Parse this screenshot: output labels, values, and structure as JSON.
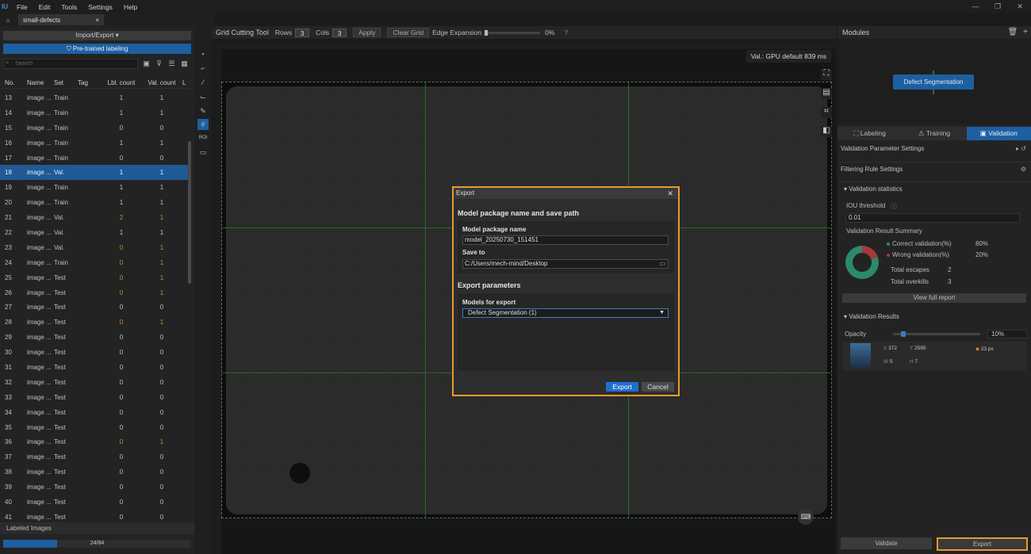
{
  "app": {
    "logo": "IU",
    "menus": [
      "File",
      "Edit",
      "Tools",
      "Settings",
      "Help"
    ],
    "window_controls": [
      "—",
      "❐",
      "✕"
    ]
  },
  "tabs": {
    "home_icon": "home-icon",
    "project": "small-defects",
    "close": "×"
  },
  "left": {
    "import_export": "Import/Export ▾",
    "pretrained": "Pre-trained labeling",
    "search_placeholder": "Search",
    "columns": [
      "No.",
      "Name",
      "Set",
      "Tag",
      "Lbl. count",
      "Val. count",
      "L"
    ],
    "rows": [
      {
        "no": "13",
        "name": "image ...",
        "set": "Train",
        "lbl": "1",
        "val": "1",
        "lblc": "",
        "valc": ""
      },
      {
        "no": "14",
        "name": "image ...",
        "set": "Train",
        "lbl": "1",
        "val": "1",
        "lblc": "",
        "valc": ""
      },
      {
        "no": "15",
        "name": "image ...",
        "set": "Train",
        "lbl": "0",
        "val": "0",
        "lblc": "",
        "valc": ""
      },
      {
        "no": "16",
        "name": "image ...",
        "set": "Train",
        "lbl": "1",
        "val": "1",
        "lblc": "",
        "valc": ""
      },
      {
        "no": "17",
        "name": "image ...",
        "set": "Train",
        "lbl": "0",
        "val": "0",
        "lblc": "",
        "valc": ""
      },
      {
        "no": "18",
        "name": "image ...",
        "set": "Val.",
        "lbl": "1",
        "val": "1",
        "lblc": "",
        "valc": "",
        "selected": true
      },
      {
        "no": "19",
        "name": "image ...",
        "set": "Train",
        "lbl": "1",
        "val": "1",
        "lblc": "",
        "valc": ""
      },
      {
        "no": "20",
        "name": "image ...",
        "set": "Train",
        "lbl": "1",
        "val": "1",
        "lblc": "",
        "valc": ""
      },
      {
        "no": "21",
        "name": "image ...",
        "set": "Val.",
        "lbl": "2",
        "val": "1",
        "lblc": "orange",
        "valc": "green"
      },
      {
        "no": "22",
        "name": "image ...",
        "set": "Val.",
        "lbl": "1",
        "val": "1",
        "lblc": "",
        "valc": ""
      },
      {
        "no": "23",
        "name": "image ...",
        "set": "Val.",
        "lbl": "0",
        "val": "1",
        "lblc": "orange",
        "valc": "green"
      },
      {
        "no": "24",
        "name": "image ...",
        "set": "Train",
        "lbl": "0",
        "val": "1",
        "lblc": "orange",
        "valc": "green"
      },
      {
        "no": "25",
        "name": "image ...",
        "set": "Test",
        "lbl": "0",
        "val": "1",
        "lblc": "orange",
        "valc": "green"
      },
      {
        "no": "26",
        "name": "image ...",
        "set": "Test",
        "lbl": "0",
        "val": "1",
        "lblc": "orange",
        "valc": "green"
      },
      {
        "no": "27",
        "name": "image ...",
        "set": "Test",
        "lbl": "0",
        "val": "0",
        "lblc": "",
        "valc": ""
      },
      {
        "no": "28",
        "name": "image ...",
        "set": "Test",
        "lbl": "0",
        "val": "1",
        "lblc": "orange",
        "valc": "green"
      },
      {
        "no": "29",
        "name": "image ...",
        "set": "Test",
        "lbl": "0",
        "val": "0",
        "lblc": "",
        "valc": ""
      },
      {
        "no": "30",
        "name": "image ...",
        "set": "Test",
        "lbl": "0",
        "val": "0",
        "lblc": "",
        "valc": ""
      },
      {
        "no": "31",
        "name": "image ...",
        "set": "Test",
        "lbl": "0",
        "val": "0",
        "lblc": "",
        "valc": ""
      },
      {
        "no": "32",
        "name": "image ...",
        "set": "Test",
        "lbl": "0",
        "val": "0",
        "lblc": "",
        "valc": ""
      },
      {
        "no": "33",
        "name": "image ...",
        "set": "Test",
        "lbl": "0",
        "val": "0",
        "lblc": "",
        "valc": ""
      },
      {
        "no": "34",
        "name": "image ...",
        "set": "Test",
        "lbl": "0",
        "val": "0",
        "lblc": "",
        "valc": ""
      },
      {
        "no": "35",
        "name": "image ...",
        "set": "Test",
        "lbl": "0",
        "val": "0",
        "lblc": "",
        "valc": ""
      },
      {
        "no": "36",
        "name": "image ...",
        "set": "Test",
        "lbl": "0",
        "val": "1",
        "lblc": "orange",
        "valc": "green"
      },
      {
        "no": "37",
        "name": "image ...",
        "set": "Test",
        "lbl": "0",
        "val": "0",
        "lblc": "",
        "valc": ""
      },
      {
        "no": "38",
        "name": "image ...",
        "set": "Test",
        "lbl": "0",
        "val": "0",
        "lblc": "",
        "valc": ""
      },
      {
        "no": "39",
        "name": "image ...",
        "set": "Test",
        "lbl": "0",
        "val": "0",
        "lblc": "",
        "valc": ""
      },
      {
        "no": "40",
        "name": "image ...",
        "set": "Test",
        "lbl": "0",
        "val": "0",
        "lblc": "",
        "valc": ""
      },
      {
        "no": "41",
        "name": "image ...",
        "set": "Test",
        "lbl": "0",
        "val": "0",
        "lblc": "",
        "valc": ""
      }
    ],
    "labeled_images": "Labeled Images",
    "progress_text": "24/84",
    "progress_fraction": 0.2857
  },
  "gridbar": {
    "title": "Grid Cutting Tool",
    "rows_label": "Rows",
    "rows_value": "3",
    "cols_label": "Cols",
    "cols_value": "3",
    "apply": "Apply",
    "clear": "Clear Grid",
    "edge_label": "Edge Expansion",
    "edge_value": "0%"
  },
  "canvas": {
    "val_info": "Val.: GPU default 839 ms"
  },
  "right": {
    "modules_title": "Modules",
    "module_node": "Defect Segmentation",
    "tabs": [
      "Labeling",
      "Training",
      "Validation"
    ],
    "active_tab": "Validation",
    "param_settings": "Validation Parameter Settings",
    "filter_rules": "Filtering Rule Settings",
    "val_stats": "Validation statistics",
    "iou_label": "IOU threshold",
    "iou_value": "0.01",
    "summary_title": "Validation Result Summary",
    "correct_label": "Correct validation(%)",
    "correct_value": "80%",
    "wrong_label": "Wrong validation(%)",
    "wrong_value": "20%",
    "correct_fraction": 0.8,
    "escapes_label": "Total escapes",
    "escapes_value": "2",
    "overkills_label": "Total overkills",
    "overkills_value": "3",
    "full_report": "View full report",
    "val_results": "Validation Results",
    "opacity_label": "Opacity",
    "opacity_value": "10%",
    "result": {
      "x_label": "X",
      "x": "372",
      "y_label": "Y",
      "y": "2595",
      "w_label": "W",
      "w": "5",
      "h_label": "H",
      "h": "7",
      "area": "23 px"
    },
    "validate_btn": "Validate",
    "export_btn": "Export"
  },
  "dialog": {
    "title": "Export",
    "close": "✕",
    "section1": "Model package name and save path",
    "name_label": "Model package name",
    "name_value": "model_20250730_151451",
    "save_label": "Save to",
    "save_value": "C:/Users/mech-mind/Desktop",
    "section2": "Export parameters",
    "models_label": "Models for export",
    "models_value": "Defect Segmentation (1)",
    "export": "Export",
    "cancel": "Cancel"
  },
  "colors": {
    "accent": "#1e5fa0",
    "highlight_border": "#e89a2f",
    "grid_line": "#2a6a2a"
  }
}
